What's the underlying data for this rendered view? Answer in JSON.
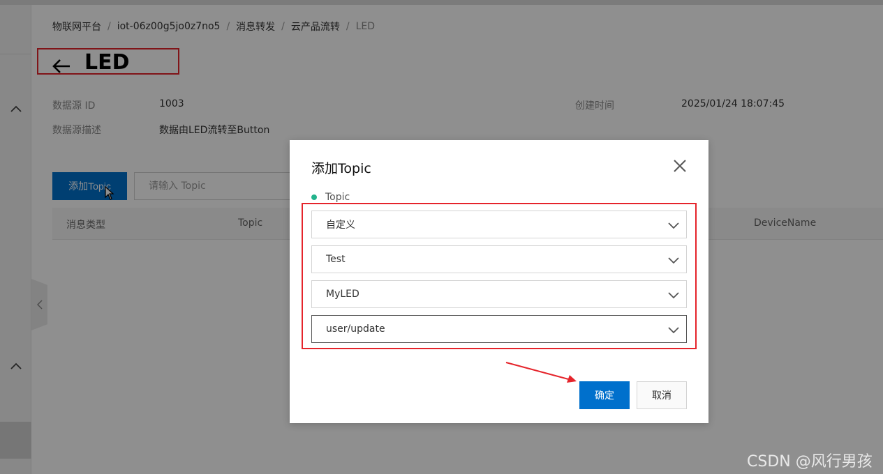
{
  "breadcrumb": {
    "items": [
      "物联网平台",
      "iot-06z00g5jo0z7no5",
      "消息转发",
      "云产品流转",
      "LED"
    ],
    "separator": "/"
  },
  "page": {
    "title": "LED"
  },
  "info": {
    "source_id_label": "数据源 ID",
    "source_id_value": "1003",
    "source_desc_label": "数据源描述",
    "source_desc_value": "数据由LED流转至Button",
    "created_label": "创建时间",
    "created_value": "2025/01/24 18:07:45"
  },
  "toolbar": {
    "add_topic_label": "添加Topic",
    "search_placeholder": "请输入 Topic"
  },
  "table": {
    "columns": [
      "消息类型",
      "Topic",
      "DeviceName"
    ]
  },
  "modal": {
    "title": "添加Topic",
    "field_label": "Topic",
    "selects": [
      {
        "value": "自定义"
      },
      {
        "value": "Test"
      },
      {
        "value": "MyLED"
      },
      {
        "value": "user/update"
      }
    ],
    "ok_label": "确定",
    "cancel_label": "取消"
  },
  "colors": {
    "primary": "#0070cc",
    "highlight": "#e5242b",
    "required_dot": "#23b38c"
  },
  "watermark": "CSDN @风行男孩"
}
